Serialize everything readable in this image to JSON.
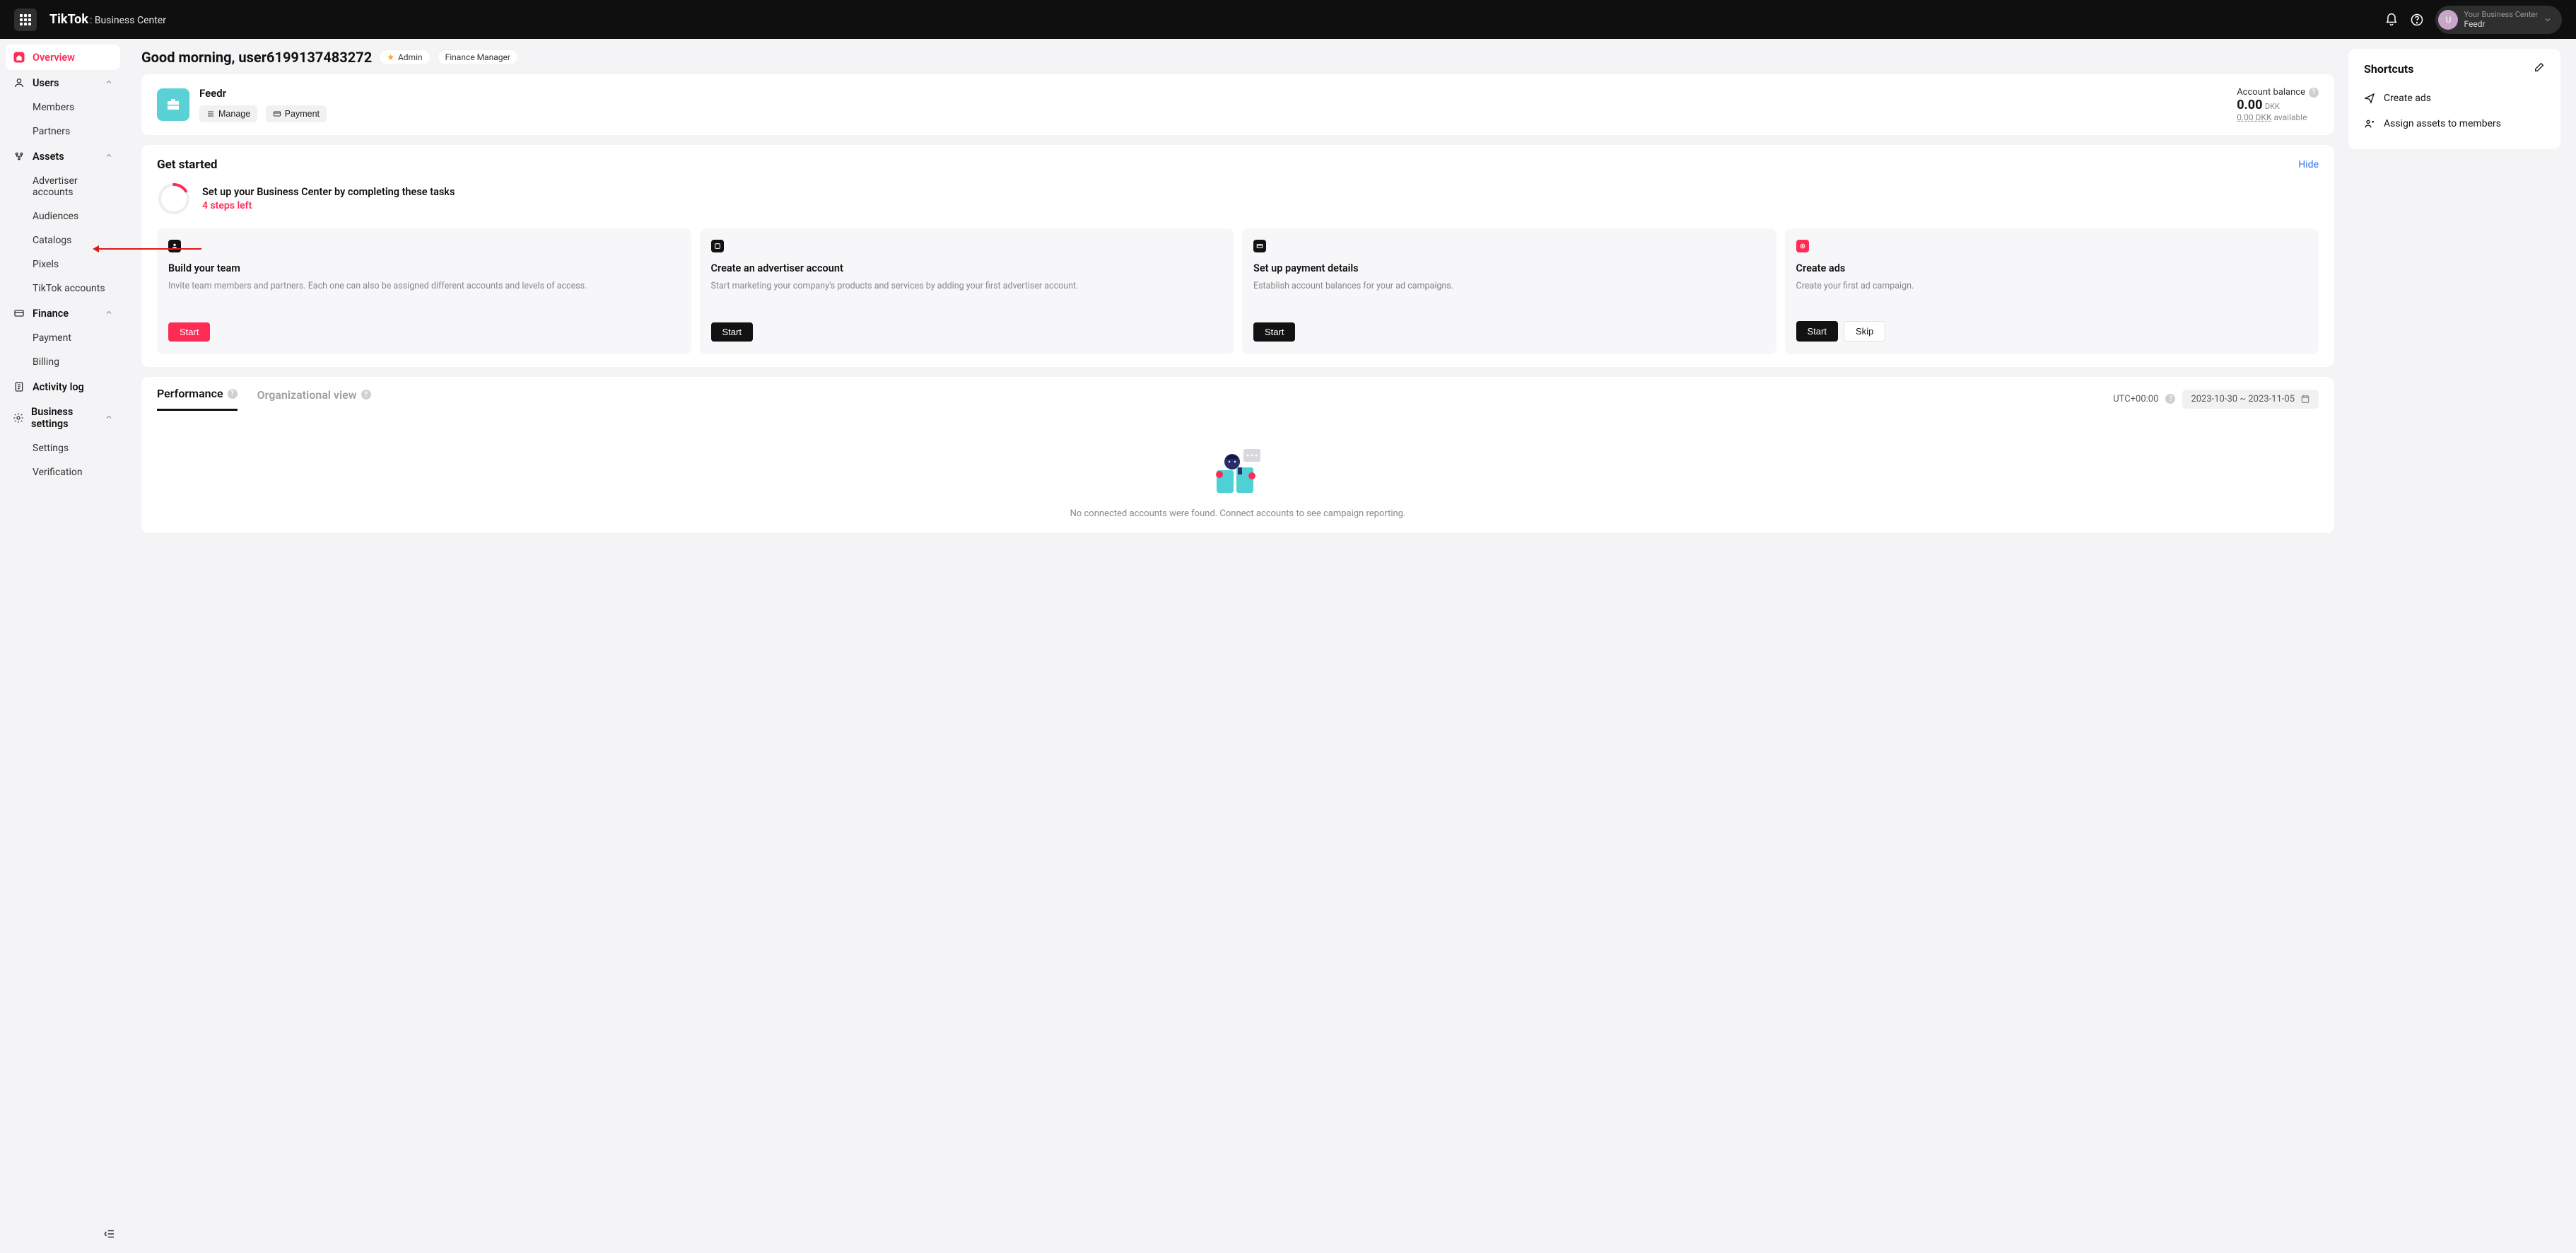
{
  "header": {
    "brand": "TikTok",
    "brand_sub": ": Business Center",
    "account_label": "Your Business Center",
    "account_name": "Feedr",
    "avatar_letter": "U"
  },
  "sidebar": {
    "overview": "Overview",
    "users": "Users",
    "members": "Members",
    "partners": "Partners",
    "assets": "Assets",
    "advertiser_accounts": "Advertiser accounts",
    "audiences": "Audiences",
    "catalogs": "Catalogs",
    "pixels": "Pixels",
    "tiktok_accounts": "TikTok accounts",
    "finance": "Finance",
    "payment": "Payment",
    "billing": "Billing",
    "activity_log": "Activity log",
    "business_settings": "Business settings",
    "settings": "Settings",
    "verification": "Verification"
  },
  "greeting": {
    "text": "Good morning, user6199137483272",
    "admin_badge": "Admin",
    "role_badge": "Finance Manager"
  },
  "org": {
    "name": "Feedr",
    "manage_btn": "Manage",
    "payment_btn": "Payment",
    "balance_label": "Account balance",
    "balance_amount": "0.00",
    "balance_currency": "DKK",
    "available_amount": "0.00 DKK",
    "available_label": "available"
  },
  "get_started": {
    "title": "Get started",
    "hide": "Hide",
    "setup_text": "Set up your Business Center by completing these tasks",
    "steps_left": "4 steps left",
    "tasks": [
      {
        "title": "Build your team",
        "desc": "Invite team members and partners. Each one can also be assigned different accounts and levels of access.",
        "start": "Start",
        "primary": true
      },
      {
        "title": "Create an advertiser account",
        "desc": "Start marketing your company's products and services by adding your first advertiser account.",
        "start": "Start"
      },
      {
        "title": "Set up payment details",
        "desc": "Establish account balances for your ad campaigns.",
        "start": "Start"
      },
      {
        "title": "Create ads",
        "desc": "Create your first ad campaign.",
        "start": "Start",
        "skip": "Skip"
      }
    ]
  },
  "performance": {
    "tab_perf": "Performance",
    "tab_org": "Organizational view",
    "tz": "UTC+00:00",
    "date_range": "2023-10-30 ~ 2023-11-05",
    "empty": "No connected accounts were found. Connect accounts to see campaign reporting."
  },
  "shortcuts": {
    "title": "Shortcuts",
    "create_ads": "Create ads",
    "assign": "Assign assets to members"
  }
}
